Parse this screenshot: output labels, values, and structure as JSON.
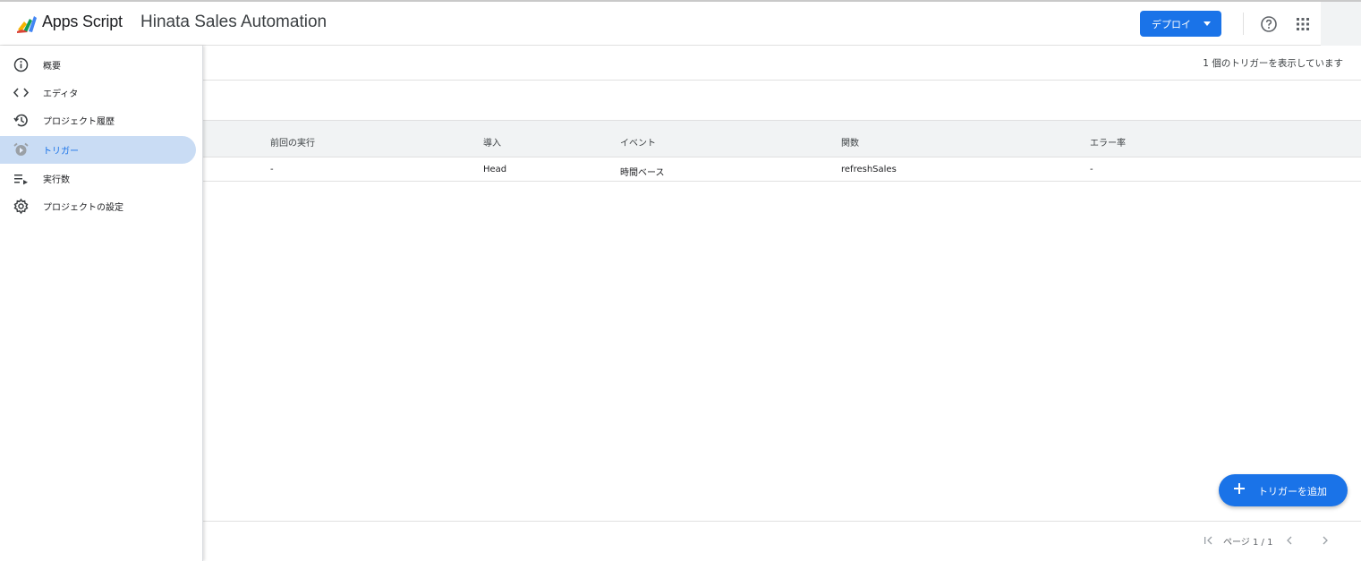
{
  "header": {
    "app_name": "Apps Script",
    "project_title": "Hinata Sales Automation",
    "deploy_label": "デプロイ",
    "icons": [
      "apps-script-logo",
      "help-icon",
      "apps-grid-icon"
    ]
  },
  "sidebar": {
    "items": [
      {
        "label": "概要",
        "icon": "info-icon"
      },
      {
        "label": "エディタ",
        "icon": "code-icon"
      },
      {
        "label": "プロジェクト履歴",
        "icon": "history-icon"
      },
      {
        "label": "トリガー",
        "icon": "alarm-icon",
        "active": true
      },
      {
        "label": "実行数",
        "icon": "executions-icon"
      },
      {
        "label": "プロジェクトの設定",
        "icon": "gear-icon"
      }
    ]
  },
  "main": {
    "trigger_count": "1 個のトリガーを表示しています",
    "columns": [
      "前回の実行",
      "導入",
      "イベント",
      "関数",
      "エラー率"
    ],
    "rows": [
      [
        "-",
        "Head",
        "時間ベース",
        "refreshSales",
        "-"
      ]
    ],
    "add_trigger_label": "トリガーを追加",
    "pagination": {
      "label": "ページ 1 / 1"
    }
  },
  "colors": {
    "accent": "#1a73e8",
    "active_nav_bg": "#c9dcf4",
    "table_header_bg": "#f1f3f4"
  }
}
